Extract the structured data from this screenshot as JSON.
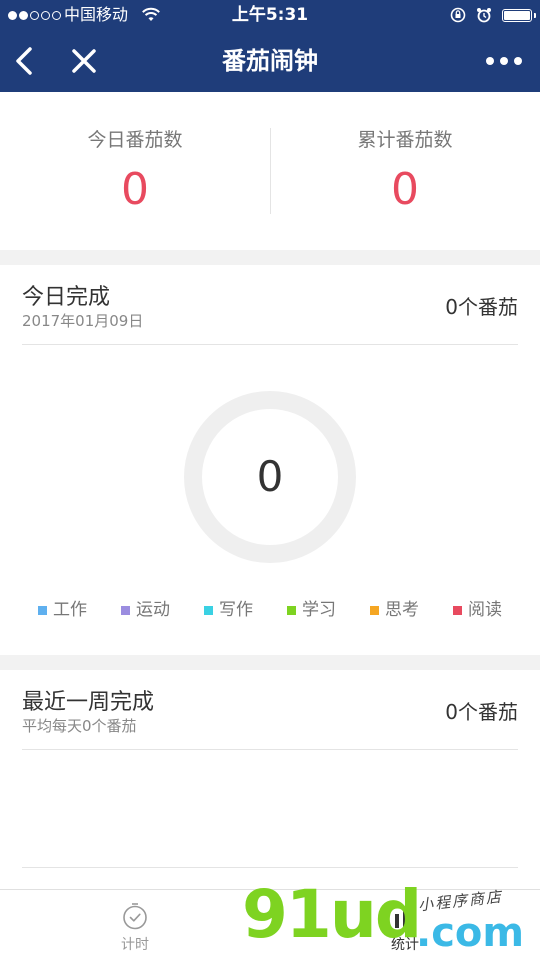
{
  "status_bar": {
    "carrier": "中国移动",
    "time": "上午5:31",
    "signal_bars_filled": 2,
    "signal_bars_total": 5
  },
  "nav": {
    "title": "番茄闹钟"
  },
  "summary": {
    "today_label": "今日番茄数",
    "today_value": "0",
    "total_label": "累计番茄数",
    "total_value": "0"
  },
  "today": {
    "title": "今日完成",
    "date": "2017年01月09日",
    "count": "0个番茄",
    "ring_value": "0",
    "legend": [
      {
        "label": "工作",
        "color": "#5fb0ef"
      },
      {
        "label": "运动",
        "color": "#9b8de0"
      },
      {
        "label": "写作",
        "color": "#3ad1e3"
      },
      {
        "label": "学习",
        "color": "#7ed321"
      },
      {
        "label": "思考",
        "color": "#f5a623"
      },
      {
        "label": "阅读",
        "color": "#e84a5f"
      }
    ]
  },
  "week": {
    "title": "最近一周完成",
    "subtitle": "平均每天0个番茄",
    "count": "0个番茄"
  },
  "tab_bar": {
    "timer_label": "计时",
    "stats_label": "统计"
  },
  "watermark": {
    "main": "91ud",
    "suffix": ".com",
    "script": "小程序商店"
  },
  "colors": {
    "nav_bg": "#1f3d7a",
    "accent_red": "#e84a5f"
  }
}
